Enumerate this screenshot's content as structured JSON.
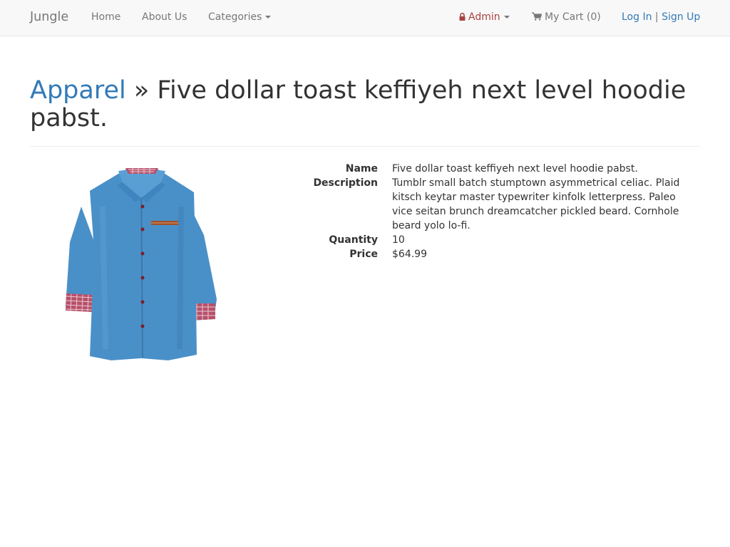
{
  "navbar": {
    "brand": "Jungle",
    "home": "Home",
    "about": "About Us",
    "categories": "Categories",
    "admin": "Admin",
    "cart": "My Cart (0)",
    "login": "Log In",
    "separator": "|",
    "signup": "Sign Up"
  },
  "header": {
    "category": "Apparel",
    "divider": "»",
    "product_name": "Five dollar toast keffiyeh next level hoodie pabst."
  },
  "details": {
    "name_label": "Name",
    "name_value": "Five dollar toast keffiyeh next level hoodie pabst.",
    "description_label": "Description",
    "description_value": "Tumblr small batch stumptown asymmetrical celiac. Plaid kitsch keytar master typewriter kinfolk letterpress. Paleo vice seitan brunch dreamcatcher pickled beard. Cornhole beard yolo lo-fi.",
    "quantity_label": "Quantity",
    "quantity_value": "10",
    "price_label": "Price",
    "price_value": "$64.99"
  },
  "colors": {
    "link": "#337ab7",
    "admin": "#a94442",
    "navbar_bg": "#f8f8f8",
    "shirt": "#4a90c8"
  },
  "icons": {
    "admin": "lock-icon",
    "cart": "shopping-cart-icon"
  }
}
